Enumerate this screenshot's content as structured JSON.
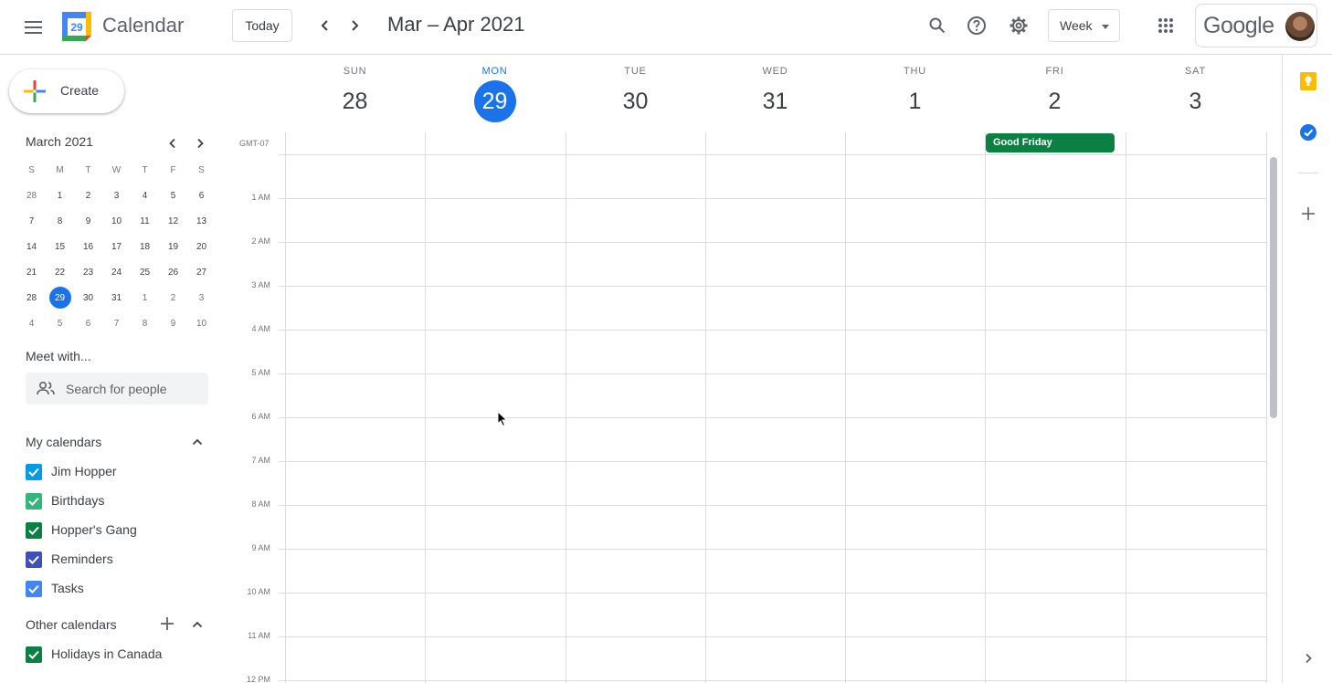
{
  "header": {
    "menu_icon": "hamburger-menu-icon",
    "logo_day": "29",
    "app_title": "Calendar",
    "today_label": "Today",
    "date_range": "Mar – Apr 2021",
    "view_label": "Week",
    "google_word": "Google"
  },
  "sidebar": {
    "create_label": "Create",
    "mini_cal": {
      "month_label": "March 2021",
      "dow": [
        "S",
        "M",
        "T",
        "W",
        "T",
        "F",
        "S"
      ],
      "weeks": [
        [
          "28",
          "1",
          "2",
          "3",
          "4",
          "5",
          "6"
        ],
        [
          "7",
          "8",
          "9",
          "10",
          "11",
          "12",
          "13"
        ],
        [
          "14",
          "15",
          "16",
          "17",
          "18",
          "19",
          "20"
        ],
        [
          "21",
          "22",
          "23",
          "24",
          "25",
          "26",
          "27"
        ],
        [
          "28",
          "29",
          "30",
          "31",
          "1",
          "2",
          "3"
        ],
        [
          "4",
          "5",
          "6",
          "7",
          "8",
          "9",
          "10"
        ]
      ],
      "selected": "29"
    },
    "meet_with": "Meet with...",
    "search_people_placeholder": "Search for people",
    "my_calendars_title": "My calendars",
    "my_calendars": [
      {
        "label": "Jim Hopper",
        "color": "#039be5"
      },
      {
        "label": "Birthdays",
        "color": "#33b679"
      },
      {
        "label": "Hopper's Gang",
        "color": "#0b8043"
      },
      {
        "label": "Reminders",
        "color": "#3f51b5"
      },
      {
        "label": "Tasks",
        "color": "#4285f4"
      }
    ],
    "other_calendars_title": "Other calendars",
    "other_calendars": [
      {
        "label": "Holidays in Canada",
        "color": "#0b8043"
      }
    ]
  },
  "week": {
    "days": [
      {
        "dow": "SUN",
        "num": "28"
      },
      {
        "dow": "MON",
        "num": "29",
        "today": true
      },
      {
        "dow": "TUE",
        "num": "30"
      },
      {
        "dow": "WED",
        "num": "31"
      },
      {
        "dow": "THU",
        "num": "1"
      },
      {
        "dow": "FRI",
        "num": "2"
      },
      {
        "dow": "SAT",
        "num": "3"
      }
    ],
    "timezone": "GMT-07",
    "hours": [
      "1 AM",
      "2 AM",
      "3 AM",
      "4 AM",
      "5 AM",
      "6 AM",
      "7 AM",
      "8 AM",
      "9 AM",
      "10 AM",
      "11 AM",
      "12 PM"
    ],
    "all_day_events": [
      {
        "title": "Good Friday",
        "day": "FRI",
        "color": "#0b8043"
      }
    ]
  },
  "colors": {
    "accent": "#1a73e8",
    "grid": "#dadce0",
    "keep_yellow": "#fbbc04",
    "tasks_blue": "#1a73e8"
  }
}
